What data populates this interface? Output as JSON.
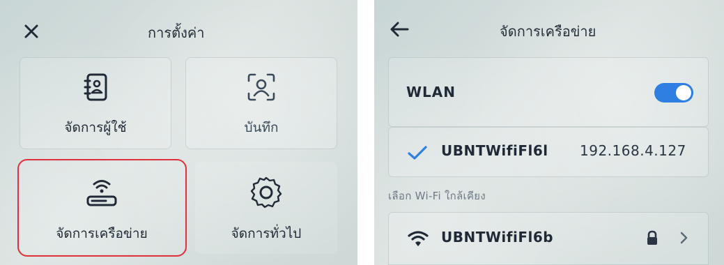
{
  "settings": {
    "title": "การตั้งค่า",
    "close_icon": "close-icon",
    "tiles": [
      {
        "label": "จัดการผู้ใช้",
        "icon": "user-contact-book-icon"
      },
      {
        "label": "บันทึก",
        "icon": "face-scan-icon"
      },
      {
        "label": "จัดการเครือข่าย",
        "icon": "wifi-router-icon",
        "highlighted": true
      },
      {
        "label": "จัดการทั่วไป",
        "icon": "gear-icon"
      }
    ],
    "highlight_color": "#e0303a"
  },
  "network": {
    "title": "จัดการเครือข่าย",
    "back_icon": "back-arrow-icon",
    "wlan_label": "WLAN",
    "wlan_enabled": true,
    "connected": {
      "ssid": "UBNTWifiFl6l",
      "ip": "192.168.4.127",
      "icon": "check-icon"
    },
    "nearby_label": "เลือก Wi-Fi ใกล้เคียง",
    "nearby": [
      {
        "ssid": "UBNTWifiFl6b",
        "secured": true,
        "icons": [
          "wifi-signal-icon",
          "lock-icon",
          "chevron-right-icon"
        ]
      }
    ],
    "accent_color": "#2f7fe3"
  }
}
